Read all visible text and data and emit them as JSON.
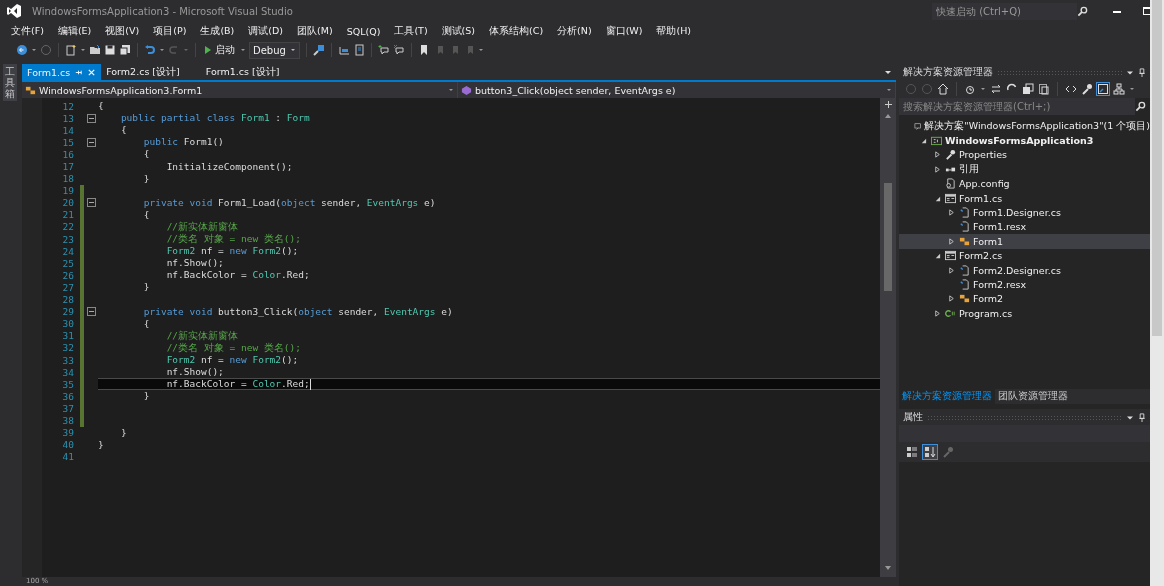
{
  "window": {
    "title": "WindowsFormsApplication3 - Microsoft Visual Studio",
    "quick_launch": {
      "placeholder": "快速启动 (Ctrl+Q)"
    }
  },
  "menu": [
    "文件(F)",
    "编辑(E)",
    "视图(V)",
    "项目(P)",
    "生成(B)",
    "调试(D)",
    "团队(M)",
    "SQL(Q)",
    "工具(T)",
    "测试(S)",
    "体系结构(C)",
    "分析(N)",
    "窗口(W)",
    "帮助(H)"
  ],
  "toolbar": {
    "start": "启动",
    "config": "Debug"
  },
  "side_tabs": [
    "工具箱"
  ],
  "doc_tabs": [
    {
      "label": "Form1.cs",
      "selected": true
    },
    {
      "label": "Form2.cs [设计]",
      "selected": false
    },
    {
      "label": "Form1.cs [设计]",
      "selected": false
    }
  ],
  "nav": {
    "type": "WindowsFormsApplication3.Form1",
    "member": "button3_Click(object sender, EventArgs e)"
  },
  "code": [
    {
      "n": "12",
      "fold": false,
      "changed": false,
      "current": false,
      "tokens": [
        {
          "kind": "plain",
          "t": "{"
        }
      ]
    },
    {
      "n": "13",
      "fold": true,
      "changed": false,
      "current": false,
      "tokens": [
        {
          "kind": "kw",
          "t": "    public partial class "
        },
        {
          "kind": "type",
          "t": "Form1"
        },
        {
          "kind": "plain",
          "t": " : "
        },
        {
          "kind": "type",
          "t": "Form"
        }
      ]
    },
    {
      "n": "14",
      "fold": false,
      "changed": false,
      "current": false,
      "tokens": [
        {
          "kind": "plain",
          "t": "    {"
        }
      ]
    },
    {
      "n": "15",
      "fold": true,
      "changed": false,
      "current": false,
      "tokens": [
        {
          "kind": "kw",
          "t": "        public "
        },
        {
          "kind": "plain",
          "t": "Form1()"
        }
      ]
    },
    {
      "n": "16",
      "fold": false,
      "changed": false,
      "current": false,
      "tokens": [
        {
          "kind": "plain",
          "t": "        {"
        }
      ]
    },
    {
      "n": "17",
      "fold": false,
      "changed": false,
      "current": false,
      "tokens": [
        {
          "kind": "plain",
          "t": "            InitializeComponent();"
        }
      ]
    },
    {
      "n": "18",
      "fold": false,
      "changed": false,
      "current": false,
      "tokens": [
        {
          "kind": "plain",
          "t": "        }"
        }
      ]
    },
    {
      "n": "19",
      "fold": false,
      "changed": true,
      "current": false
    },
    {
      "n": "20",
      "fold": true,
      "changed": true,
      "current": false,
      "tokens": [
        {
          "kind": "kw",
          "t": "        private void "
        },
        {
          "kind": "plain",
          "t": "Form1_Load("
        },
        {
          "kind": "kw",
          "t": "object"
        },
        {
          "kind": "plain",
          "t": " sender, "
        },
        {
          "kind": "type",
          "t": "EventArgs"
        },
        {
          "kind": "plain",
          "t": " e)"
        }
      ]
    },
    {
      "n": "21",
      "fold": false,
      "changed": true,
      "current": false,
      "tokens": [
        {
          "kind": "plain",
          "t": "        {"
        }
      ]
    },
    {
      "n": "22",
      "fold": false,
      "changed": true,
      "current": false,
      "tokens": [
        {
          "kind": "comment",
          "t": "            //新实体新窗体"
        }
      ]
    },
    {
      "n": "23",
      "fold": false,
      "changed": true,
      "current": false,
      "tokens": [
        {
          "kind": "comment",
          "t": "            //类名 对象 = new 类名();"
        }
      ]
    },
    {
      "n": "24",
      "fold": false,
      "changed": true,
      "current": false,
      "tokens": [
        {
          "kind": "type",
          "t": "            Form2"
        },
        {
          "kind": "plain",
          "t": " nf = "
        },
        {
          "kind": "kw",
          "t": "new "
        },
        {
          "kind": "type",
          "t": "Form2"
        },
        {
          "kind": "plain",
          "t": "();"
        }
      ]
    },
    {
      "n": "25",
      "fold": false,
      "changed": true,
      "current": false,
      "tokens": [
        {
          "kind": "plain",
          "t": "            nf.Show();"
        }
      ]
    },
    {
      "n": "26",
      "fold": false,
      "changed": true,
      "current": false,
      "tokens": [
        {
          "kind": "plain",
          "t": "            nf.BackColor = "
        },
        {
          "kind": "type",
          "t": "Color"
        },
        {
          "kind": "plain",
          "t": ".Red;"
        }
      ]
    },
    {
      "n": "27",
      "fold": false,
      "changed": true,
      "current": false,
      "tokens": [
        {
          "kind": "plain",
          "t": "        }"
        }
      ]
    },
    {
      "n": "28",
      "fold": false,
      "changed": true,
      "current": false
    },
    {
      "n": "29",
      "fold": true,
      "changed": true,
      "current": false,
      "tokens": [
        {
          "kind": "kw",
          "t": "        private void "
        },
        {
          "kind": "plain",
          "t": "button3_Click("
        },
        {
          "kind": "kw",
          "t": "object"
        },
        {
          "kind": "plain",
          "t": " sender, "
        },
        {
          "kind": "type",
          "t": "EventArgs"
        },
        {
          "kind": "plain",
          "t": " e)"
        }
      ]
    },
    {
      "n": "30",
      "fold": false,
      "changed": true,
      "current": false,
      "tokens": [
        {
          "kind": "plain",
          "t": "        {"
        }
      ]
    },
    {
      "n": "31",
      "fold": false,
      "changed": true,
      "current": false,
      "tokens": [
        {
          "kind": "comment",
          "t": "            //新实体新窗体"
        }
      ]
    },
    {
      "n": "32",
      "fold": false,
      "changed": true,
      "current": false,
      "tokens": [
        {
          "kind": "comment",
          "t": "            //类名 对象 = new 类名();"
        }
      ]
    },
    {
      "n": "33",
      "fold": false,
      "changed": true,
      "current": false,
      "tokens": [
        {
          "kind": "type",
          "t": "            Form2"
        },
        {
          "kind": "plain",
          "t": " nf = "
        },
        {
          "kind": "kw",
          "t": "new "
        },
        {
          "kind": "type",
          "t": "Form2"
        },
        {
          "kind": "plain",
          "t": "();"
        }
      ]
    },
    {
      "n": "34",
      "fold": false,
      "changed": true,
      "current": false,
      "tokens": [
        {
          "kind": "plain",
          "t": "            nf.Show();"
        }
      ]
    },
    {
      "n": "35",
      "fold": false,
      "changed": true,
      "current": true,
      "tokens": [
        {
          "kind": "plain",
          "t": "            nf.BackColor = "
        },
        {
          "kind": "type",
          "t": "Color"
        },
        {
          "kind": "plain",
          "t": ".Red;"
        }
      ]
    },
    {
      "n": "36",
      "fold": false,
      "changed": true,
      "current": false,
      "tokens": [
        {
          "kind": "plain",
          "t": "        }"
        }
      ]
    },
    {
      "n": "37",
      "fold": false,
      "changed": true,
      "current": false
    },
    {
      "n": "38",
      "fold": false,
      "changed": true,
      "current": false
    },
    {
      "n": "39",
      "fold": false,
      "changed": false,
      "current": false,
      "tokens": [
        {
          "kind": "plain",
          "t": "    }"
        }
      ]
    },
    {
      "n": "40",
      "fold": false,
      "changed": false,
      "current": false,
      "tokens": [
        {
          "kind": "plain",
          "t": "}"
        }
      ]
    },
    {
      "n": "41",
      "fold": false,
      "changed": false,
      "current": false
    }
  ],
  "zoom": "100 %",
  "solution_explorer": {
    "title": "解决方案资源管理器",
    "search": {
      "placeholder": "搜索解决方案资源管理器(Ctrl+;)"
    },
    "tree": [
      {
        "label": "解决方案\"WindowsFormsApplication3\"(1 个项目)",
        "kind": "solution",
        "selected": false,
        "children": [
          {
            "label": "WindowsFormsApplication3",
            "kind": "project",
            "expanded": true,
            "selected": false,
            "children": [
              {
                "label": "Properties",
                "kind": "wrench",
                "expanded": false,
                "selected": false
              },
              {
                "label": "引用",
                "kind": "refs",
                "expanded": false,
                "selected": false
              },
              {
                "label": "App.config",
                "kind": "config",
                "selected": false
              },
              {
                "label": "Form1.cs",
                "kind": "form",
                "expanded": true,
                "selected": false,
                "children": [
                  {
                    "label": "Form1.Designer.cs",
                    "kind": "file",
                    "expanded": false,
                    "selected": false
                  },
                  {
                    "label": "Form1.resx",
                    "kind": "file",
                    "selected": false
                  },
                  {
                    "label": "Form1",
                    "kind": "class",
                    "expanded": false,
                    "selected": true
                  }
                ]
              },
              {
                "label": "Form2.cs",
                "kind": "form",
                "expanded": true,
                "selected": false,
                "children": [
                  {
                    "label": "Form2.Designer.cs",
                    "kind": "file",
                    "expanded": false,
                    "selected": false
                  },
                  {
                    "label": "Form2.resx",
                    "kind": "file",
                    "selected": false
                  },
                  {
                    "label": "Form2",
                    "kind": "class",
                    "expanded": false,
                    "selected": false
                  }
                ]
              },
              {
                "label": "Program.cs",
                "kind": "cs",
                "expanded": false,
                "selected": false
              }
            ]
          }
        ]
      }
    ]
  },
  "panel_tabs": [
    {
      "label": "解决方案资源管理器",
      "selected": true
    },
    {
      "label": "团队资源管理器",
      "selected": false
    }
  ],
  "properties": {
    "title": "属性",
    "views": [
      {
        "kind": "categorized",
        "selected": false
      },
      {
        "kind": "alphabetical",
        "selected": true
      },
      {
        "kind": "pages",
        "selected": false
      }
    ]
  }
}
